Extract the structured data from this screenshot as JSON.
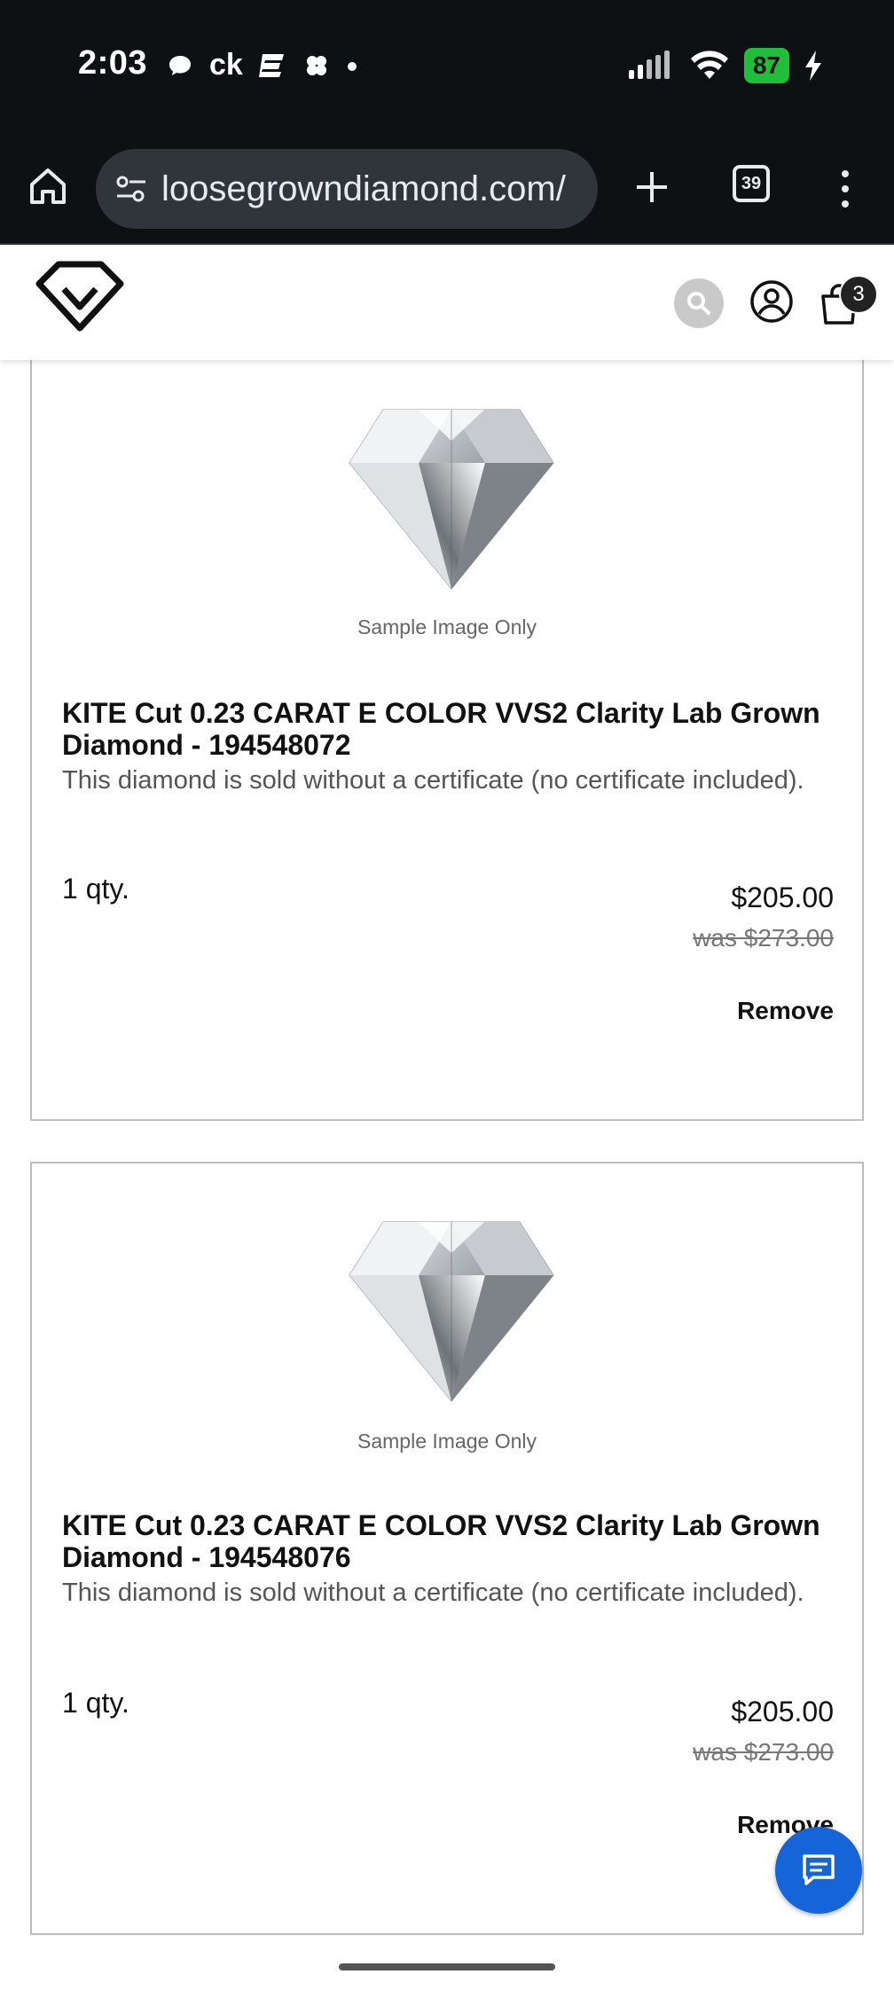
{
  "status_bar": {
    "time": "2:03",
    "carrier_text": "ck",
    "battery_level": "87"
  },
  "browser": {
    "url": "loosegrowndiamond.com/",
    "tab_count": "39"
  },
  "header": {
    "cart_count": "3"
  },
  "cart_items": [
    {
      "caption": "Sample Image Only",
      "title": "KITE Cut 0.23 CARAT E COLOR VVS2 Clarity Lab Grown Diamond - 194548072",
      "description": "This diamond is sold without a certificate (no certificate included).",
      "quantity": "1 qty.",
      "price": "$205.00",
      "was_price": "was $273.00",
      "remove_label": "Remove"
    },
    {
      "caption": "Sample Image Only",
      "title": "KITE Cut 0.23 CARAT E COLOR VVS2 Clarity Lab Grown Diamond - 194548076",
      "description": "This diamond is sold without a certificate (no certificate included).",
      "quantity": "1 qty.",
      "price": "$205.00",
      "was_price": "was $273.00",
      "remove_label": "Remove"
    }
  ],
  "colors": {
    "chat_button": "#1565d8",
    "battery": "#1fbf3a"
  }
}
